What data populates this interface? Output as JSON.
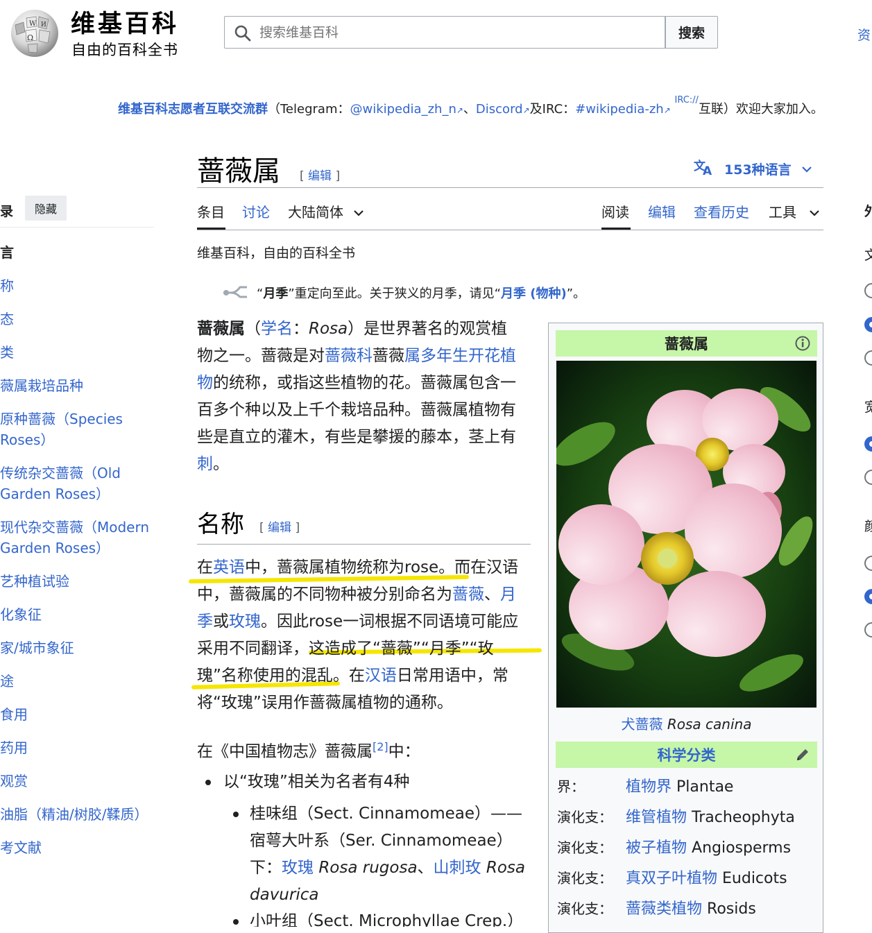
{
  "header": {
    "wordmark": "维基百科",
    "tagline": "自由的百科全书",
    "search_placeholder": "搜索维基百科",
    "search_button": "搜索",
    "right_cut_text": "资"
  },
  "site_notice": {
    "group": "维基百科志愿者互联交流群",
    "p1": "（Telegram：",
    "telegram": "@wikipedia_zh_n",
    "sep1": "、",
    "discord": "Discord",
    "p2": "及IRC：",
    "irc": "#wikipedia-zh",
    "irc_sup": "IRC://",
    "p3": "互联）欢迎大家加入。"
  },
  "toc": {
    "title": "录",
    "hide": "隐藏",
    "items": [
      "言",
      "称",
      "态",
      "类",
      "薇属栽培品种",
      "原种蔷薇（Species",
      "Roses）",
      "传统杂交蔷薇（Old",
      "Garden Roses）",
      "现代杂交蔷薇（Modern",
      "Garden Roses）",
      "艺种植试验",
      "化象征",
      "家/城市象征",
      "途",
      "食用",
      "药用",
      "观赏",
      "油脂（精油/树胶/鞣质）",
      "考文献"
    ]
  },
  "title": {
    "text": "蔷薇属",
    "edit_open": "[ ",
    "edit": "编辑",
    "edit_close": " ]",
    "languages": "153种语言"
  },
  "tabs": {
    "article": "条目",
    "talk": "讨论",
    "variant": "大陆简体",
    "read": "阅读",
    "edit": "编辑",
    "history": "查看历史",
    "tools": "工具"
  },
  "site_sub": "维基百科，自由的百科全书",
  "hatnote": {
    "a": "“",
    "b": "月季",
    "c": "”重定向至此。关于狭义的月季，请见“",
    "link": "月季 (物种)",
    "d": "”。"
  },
  "intro": {
    "l1a": "蔷薇属",
    "l1b": "（",
    "l1c": "学名",
    "l1d": "：",
    "l1e": "Rosa",
    "l1f": "）是世界著名的观赏植",
    "l2a": "物之一。蔷薇是对",
    "l2b": "蔷薇科",
    "l2c": "蔷薇",
    "l2d": "属",
    "l2e": "多年生",
    "l2f": "开花植",
    "l3a": "物",
    "l3b": "的统称，或指这些植物的花。蔷薇属包含一",
    "l4": "百多个种以及上千个栽培品种。蔷薇属植物有",
    "l5": "些是直立的灌木，有些是攀援的藤本，茎上有",
    "l6a": "刺",
    "l6b": "。"
  },
  "section_name": {
    "heading": "名称",
    "edit_open": "[ ",
    "edit": "编辑",
    "edit_close": " ]",
    "l1a": "在",
    "l1b": "英语",
    "l1c": "中，蔷薇属植物统称为rose。而在汉语",
    "l2a": "中，蔷薇属的不同物种被分别命名为",
    "l2b": "蔷薇",
    "l2c": "、",
    "l2d": "月",
    "l3a": "季",
    "l3b": "或",
    "l3c": "玫瑰",
    "l3d": "。因此rose一词根据不同语境可能应",
    "l4": "采用不同翻译，这造成了“蔷薇”“月季”“玫",
    "l5a": "瑰”名称使用的混乱。在",
    "l5b": "汉语",
    "l5c": "日常用语中，常",
    "l6": "将“玫瑰”误用作蔷薇属植物的通称。"
  },
  "flora": {
    "a": "在《中国植物志》蔷薇属",
    "ref": "[2]",
    "b": "中：",
    "li1": "以“玫瑰”相关为名者有4种",
    "li2a": "桂味组（Sect. Cinnamomeae）——",
    "li2b": "宿萼大叶系（Ser. Cinnamomeae）",
    "li2c1": "下：",
    "li2c2": "玫瑰",
    "li2c3": "Rosa rugosa",
    "li2c4": "、",
    "li2c5": "山刺玫",
    "li2c6": "Rosa",
    "li2d": "davurica",
    "li3": "小叶组（Sect. Microphyllae Crep.）"
  },
  "infobox": {
    "title": "蔷薇属",
    "caption_link": "犬蔷薇",
    "caption_italic": "Rosa canina",
    "taxo_header": "科学分类",
    "rows": [
      {
        "k": "界：",
        "link": "植物界",
        "v": "Plantae"
      },
      {
        "k": "演化支：",
        "link": "维管植物",
        "v": "Tracheophyta"
      },
      {
        "k": "演化支：",
        "link": "被子植物",
        "v": "Angiosperms"
      },
      {
        "k": "演化支：",
        "link": "真双子叶植物",
        "v": "Eudicots"
      },
      {
        "k": "演化支：",
        "link": "蔷薇类植物",
        "v": "Rosids"
      }
    ]
  },
  "right_panel": {
    "t1": "外",
    "t2": "文",
    "t3": "宽",
    "t4": "颜"
  },
  "colors": {
    "link": "#3366cc",
    "highlight": "#f5e600",
    "infobox_header": "#c6f6a8"
  }
}
